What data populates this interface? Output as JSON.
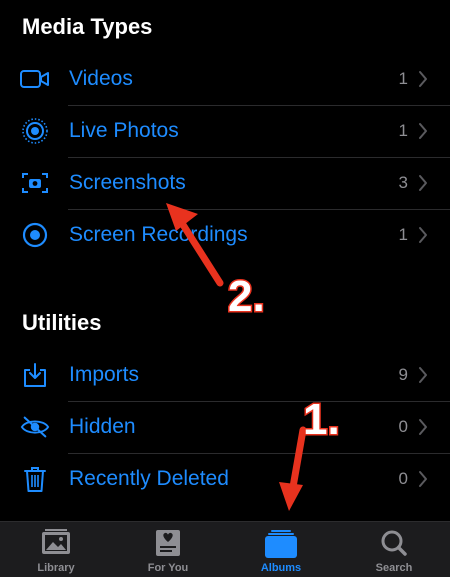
{
  "sections": {
    "media_types": {
      "title": "Media Types",
      "items": [
        {
          "label": "Videos",
          "count": "1",
          "icon": "video-icon"
        },
        {
          "label": "Live Photos",
          "count": "1",
          "icon": "live-photo-icon"
        },
        {
          "label": "Screenshots",
          "count": "3",
          "icon": "screenshot-icon"
        },
        {
          "label": "Screen Recordings",
          "count": "1",
          "icon": "screen-recording-icon"
        }
      ]
    },
    "utilities": {
      "title": "Utilities",
      "items": [
        {
          "label": "Imports",
          "count": "9",
          "icon": "import-icon"
        },
        {
          "label": "Hidden",
          "count": "0",
          "icon": "eye-slash-icon"
        },
        {
          "label": "Recently Deleted",
          "count": "0",
          "icon": "trash-icon"
        }
      ]
    }
  },
  "tabbar": {
    "tabs": [
      {
        "label": "Library",
        "icon": "library-icon"
      },
      {
        "label": "For You",
        "icon": "for-you-icon"
      },
      {
        "label": "Albums",
        "icon": "albums-icon",
        "active": true
      },
      {
        "label": "Search",
        "icon": "search-icon"
      }
    ]
  },
  "annotations": {
    "step1": "1.",
    "step2": "2."
  },
  "colors": {
    "accent": "#1e8cff",
    "annotation": "#e8321e",
    "secondary_text": "#8e8e93"
  }
}
